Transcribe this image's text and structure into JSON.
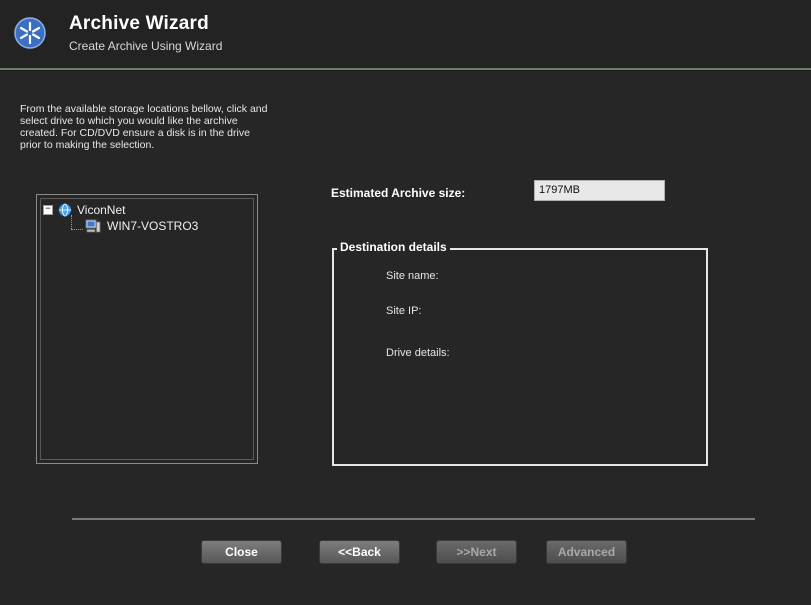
{
  "header": {
    "title": "Archive Wizard",
    "subtitle": "Create Archive Using Wizard"
  },
  "instructions": "From the available storage locations bellow, click and select drive to which you would like the archive created. For CD/DVD ensure a disk is in the drive prior to making the selection.",
  "tree": {
    "root": {
      "label": "ViconNet",
      "expander": "−"
    },
    "children": [
      {
        "label": "WIN7-VOSTRO3"
      }
    ]
  },
  "estimate": {
    "label": "Estimated Archive size:",
    "value": "1797MB"
  },
  "destination": {
    "legend": "Destination details",
    "site_name_label": "Site name:",
    "site_ip_label": "Site IP:",
    "drive_details_label": "Drive details:"
  },
  "buttons": {
    "close": "Close",
    "back": "<<Back",
    "next": ">>Next",
    "advanced": "Advanced"
  },
  "icons": {
    "logo": "vicon-logo-icon",
    "network": "network-globe-icon",
    "computer": "computer-icon"
  },
  "colors": {
    "background": "#262626",
    "header_separator": "#6d7f69",
    "logo_blue": "#3b6fc0"
  }
}
